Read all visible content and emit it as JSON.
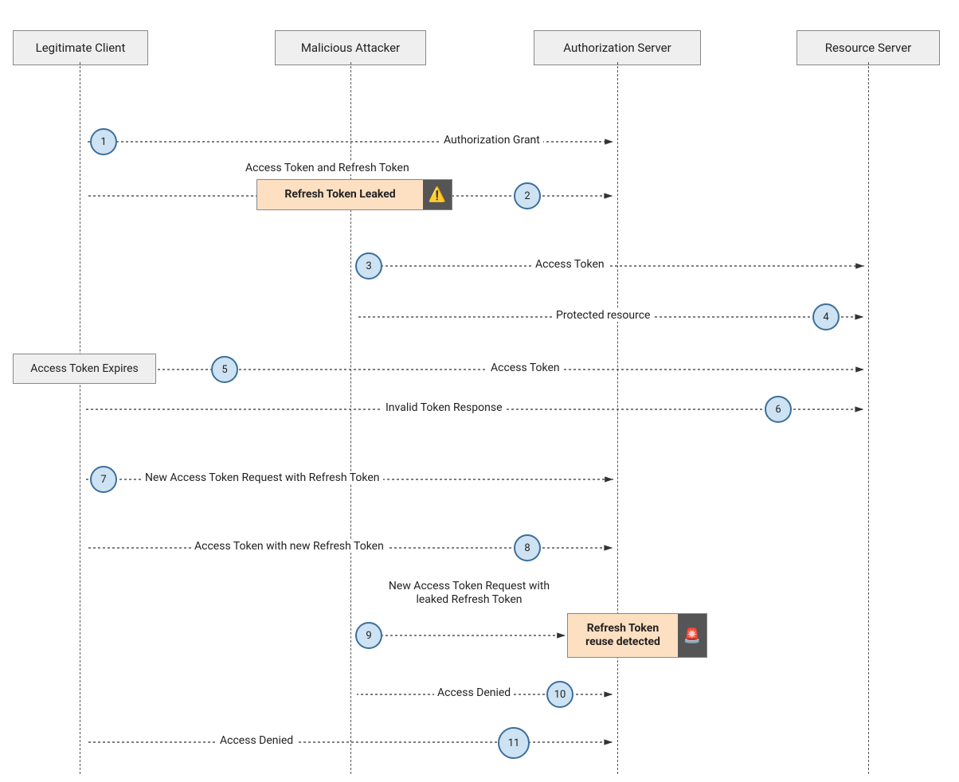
{
  "participants": [
    {
      "id": "client",
      "label": "Legitimate Client"
    },
    {
      "id": "attacker",
      "label": "Malicious Attacker"
    },
    {
      "id": "auth",
      "label": "Authorization Server"
    },
    {
      "id": "resource",
      "label": "Resource Server"
    }
  ],
  "steps": {
    "s1": "1",
    "s2": "2",
    "s3": "3",
    "s4": "4",
    "s5": "5",
    "s6": "6",
    "s7": "7",
    "s8": "8",
    "s9": "9",
    "s10": "10",
    "s11": "11"
  },
  "messages": {
    "m1": "Authorization Grant",
    "m2a": "Access Token  and Refresh Token",
    "m3": "Access Token",
    "m4": "Protected resource",
    "expires": "Access Token Expires",
    "m5": "Access Token",
    "m6": "Invalid Token Response",
    "m7": "New Access Token Request with Refresh Token",
    "m8": "Access Token with new Refresh Token",
    "m9": "New Access Token Request\nwith leaked Refresh Token",
    "m10": "Access Denied",
    "m11": "Access Denied"
  },
  "alerts": {
    "leaked": "Refresh Token Leaked",
    "reuse": "Refresh Token\nreuse detected"
  }
}
